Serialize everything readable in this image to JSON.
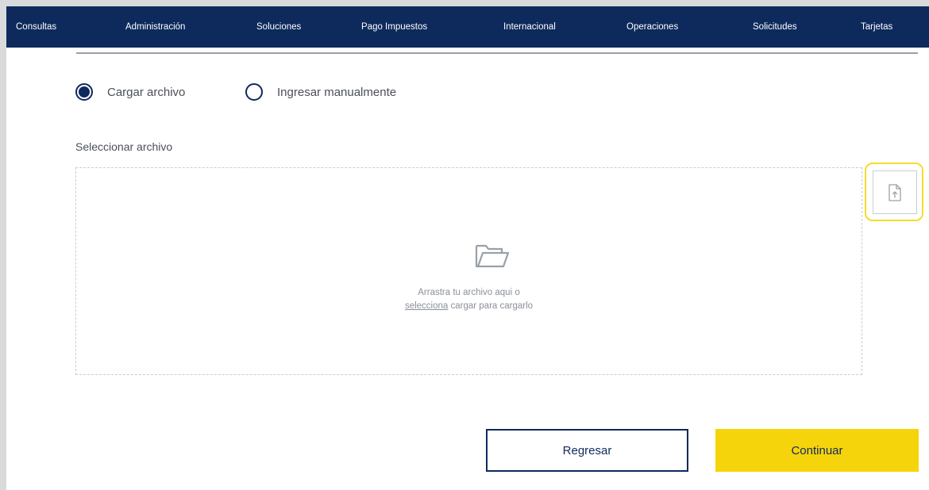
{
  "nav": {
    "items": [
      {
        "label": "Consultas"
      },
      {
        "label": "Administración"
      },
      {
        "label": "Soluciones"
      },
      {
        "label": "Pago Impuestos"
      },
      {
        "label": "Internacional"
      },
      {
        "label": "Operaciones"
      },
      {
        "label": "Solicitudes"
      },
      {
        "label": "Tarjetas"
      }
    ]
  },
  "upload_mode": {
    "options": [
      {
        "label": "Cargar archivo",
        "selected": true
      },
      {
        "label": "Ingresar manualmente",
        "selected": false
      }
    ]
  },
  "file_select": {
    "label": "Seleccionar archivo",
    "dropzone_line1": "Arrastra tu archivo aqui o",
    "dropzone_link": "selecciona",
    "dropzone_line2_rest": " cargar para cargarlo"
  },
  "actions": {
    "back_label": "Regresar",
    "continue_label": "Continuar"
  },
  "colors": {
    "nav_bg": "#0e2a5c",
    "accent_yellow": "#f6d40c",
    "highlight_yellow": "#f6dc2b",
    "text_gray": "#4a4f57"
  }
}
